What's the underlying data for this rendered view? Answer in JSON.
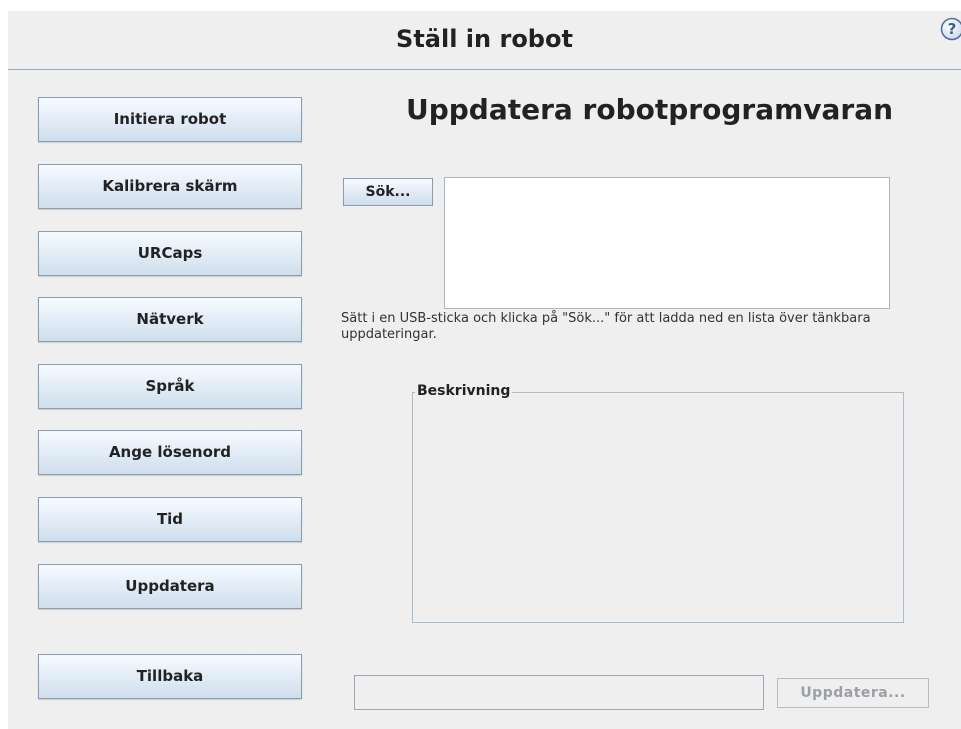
{
  "header": {
    "title": "Ställ in robot",
    "help_icon": "help-icon"
  },
  "sidebar": {
    "items": [
      {
        "label": "Initiera robot"
      },
      {
        "label": "Kalibrera skärm"
      },
      {
        "label": "URCaps"
      },
      {
        "label": "Nätverk"
      },
      {
        "label": "Språk"
      },
      {
        "label": "Ange lösenord"
      },
      {
        "label": "Tid"
      },
      {
        "label": "Uppdatera"
      },
      {
        "label": "Tillbaka"
      }
    ]
  },
  "main": {
    "title": "Uppdatera robotprogramvaran",
    "search_button": "Sök...",
    "hint": "Sätt i en USB-sticka och klicka på \"Sök...\" för att ladda ned en lista över tänkbara uppdateringar.",
    "description_label": "Beskrivning",
    "path_value": "",
    "update_button": "Uppdatera..."
  }
}
